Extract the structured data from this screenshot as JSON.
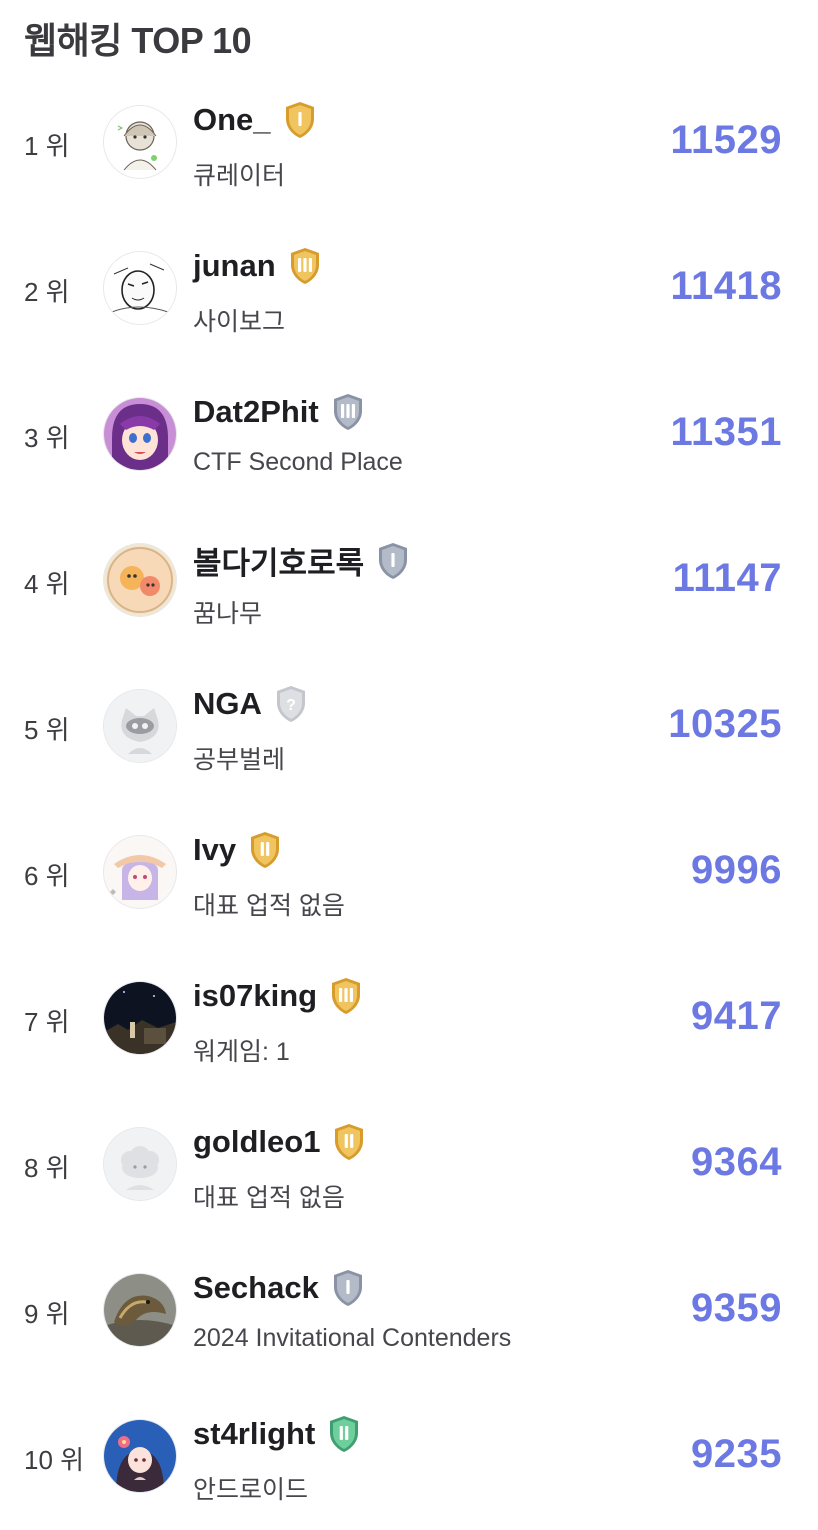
{
  "header": {
    "title": "웹해킹 TOP 10"
  },
  "colors": {
    "score": "#6d79e3",
    "tier_gold": "#e2b24b",
    "tier_silver": "#9aa2b3",
    "tier_unknown": "#d3d5da",
    "tier_platinum": "#57b88a"
  },
  "ranking": [
    {
      "rank": "1 위",
      "name": "One_",
      "subtitle": "큐레이터",
      "score": "11529",
      "tier": "gold",
      "tier_mark": "I",
      "avatar_icon": "anime-character-avatar"
    },
    {
      "rank": "2 위",
      "name": "junan",
      "subtitle": "사이보그",
      "score": "11418",
      "tier": "gold",
      "tier_mark": "III",
      "avatar_icon": "sketch-character-avatar"
    },
    {
      "rank": "3 위",
      "name": "Dat2Phit",
      "subtitle": "CTF Second Place",
      "score": "11351",
      "tier": "silver",
      "tier_mark": "III",
      "avatar_icon": "anime-girl-avatar"
    },
    {
      "rank": "4 위",
      "name": "볼다기호로록",
      "subtitle": "꿈나무",
      "score": "11147",
      "tier": "silver",
      "tier_mark": "I",
      "avatar_icon": "cartoon-dogs-avatar"
    },
    {
      "rank": "5 위",
      "name": "NGA",
      "subtitle": "공부벌레",
      "score": "10325",
      "tier": "unknown",
      "tier_mark": "?",
      "avatar_icon": "default-cat-avatar"
    },
    {
      "rank": "6 위",
      "name": "Ivy",
      "subtitle": "대표 업적 없음",
      "score": "9996",
      "tier": "gold",
      "tier_mark": "II",
      "avatar_icon": "anime-girl-hat-avatar"
    },
    {
      "rank": "7 위",
      "name": "is07king",
      "subtitle": "워게임: 1",
      "score": "9417",
      "tier": "gold",
      "tier_mark": "III",
      "avatar_icon": "night-photo-avatar"
    },
    {
      "rank": "8 위",
      "name": "goldleo1",
      "subtitle": "대표 업적 없음",
      "score": "9364",
      "tier": "gold",
      "tier_mark": "II",
      "avatar_icon": "default-sheep-avatar"
    },
    {
      "rank": "9 위",
      "name": "Sechack",
      "subtitle": "2024 Invitational Contenders",
      "score": "9359",
      "tier": "silver",
      "tier_mark": "I",
      "avatar_icon": "lizard-photo-avatar"
    },
    {
      "rank": "10 위",
      "name": "st4rlight",
      "subtitle": "안드로이드",
      "score": "9235",
      "tier": "platinum",
      "tier_mark": "II",
      "avatar_icon": "anime-girl-flower-avatar"
    }
  ]
}
